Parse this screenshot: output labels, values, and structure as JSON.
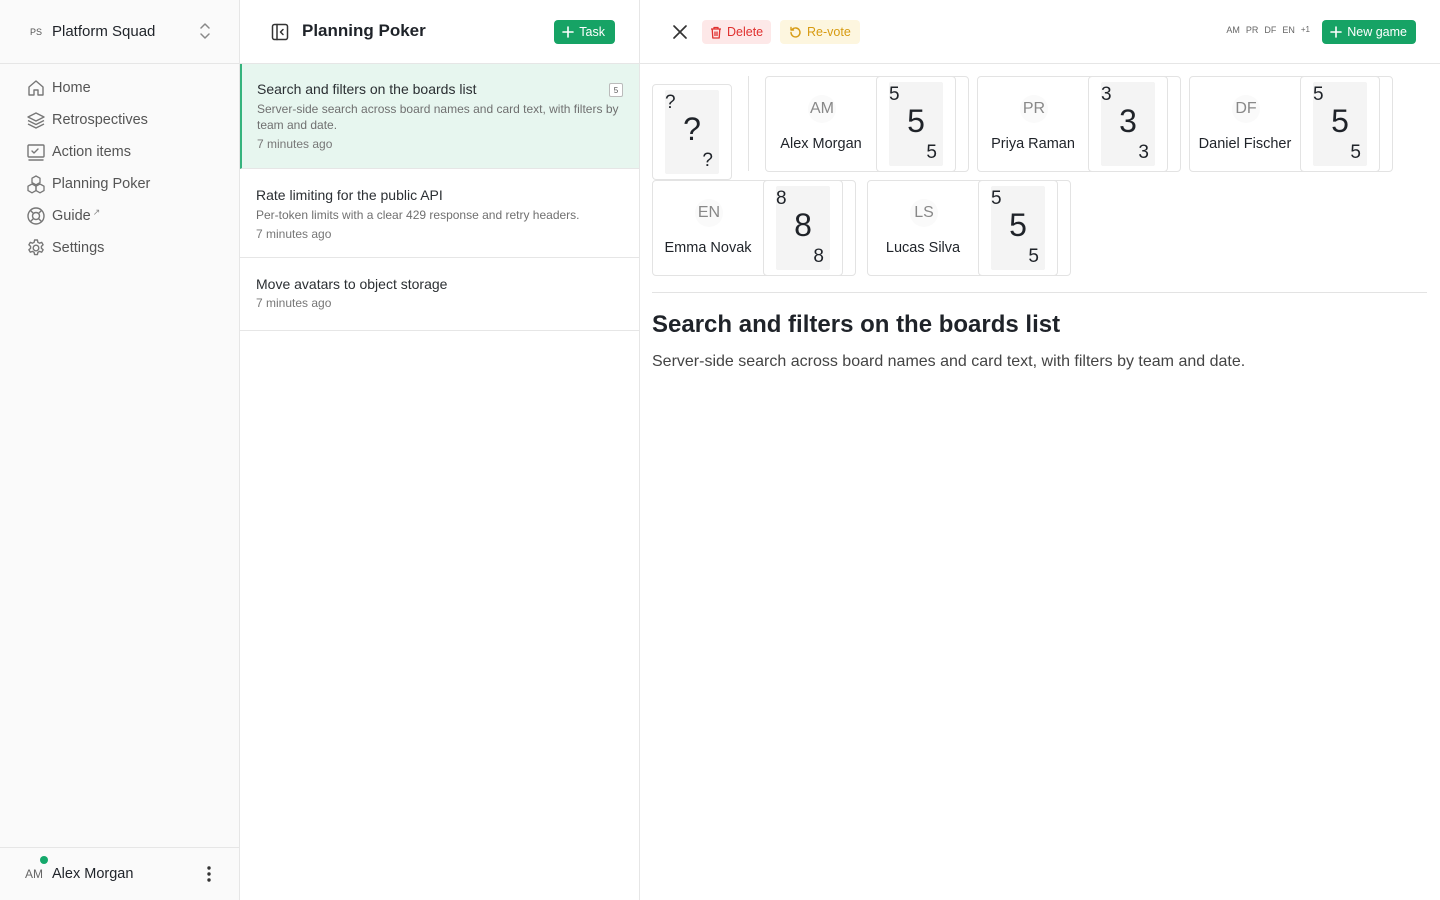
{
  "sidebar": {
    "team": {
      "initials": "PS",
      "name": "Platform Squad"
    },
    "nav": [
      {
        "label": "Home",
        "icon": "home-icon"
      },
      {
        "label": "Retrospectives",
        "icon": "layers-icon"
      },
      {
        "label": "Action items",
        "icon": "checklist-icon"
      },
      {
        "label": "Planning Poker",
        "icon": "cubes-icon"
      },
      {
        "label": "Guide",
        "icon": "lifebuoy-icon",
        "external": "↗"
      },
      {
        "label": "Settings",
        "icon": "gear-icon"
      }
    ],
    "user": {
      "initials": "AM",
      "name": "Alex Morgan",
      "online": true
    }
  },
  "tasklist": {
    "title": "Planning Poker",
    "add_button": "Task",
    "items": [
      {
        "title": "Search and filters on the boards list",
        "description": "Server-side search across board names and card text, with filters by team and date.",
        "time": "7 minutes ago",
        "estimate": "5",
        "active": true
      },
      {
        "title": "Rate limiting for the public API",
        "description": "Per-token limits with a clear 429 response and retry headers.",
        "time": "7 minutes ago"
      },
      {
        "title": "Move avatars to object storage",
        "time": "7 minutes ago"
      }
    ]
  },
  "detail": {
    "toolbar": {
      "delete_label": "Delete",
      "revote_label": "Re-vote",
      "new_game_label": "New game"
    },
    "participants": [
      "AM",
      "PR",
      "DF",
      "EN",
      "+1"
    ],
    "my_card": "?",
    "votes": [
      {
        "initials": "AM",
        "name": "Alex Morgan",
        "value": "5"
      },
      {
        "initials": "PR",
        "name": "Priya Raman",
        "value": "3"
      },
      {
        "initials": "DF",
        "name": "Daniel Fischer",
        "value": "5"
      },
      {
        "initials": "EN",
        "name": "Emma Novak",
        "value": "8"
      },
      {
        "initials": "LS",
        "name": "Lucas Silva",
        "value": "5"
      }
    ],
    "story": {
      "title": "Search and filters on the boards list",
      "description": "Server-side search across board names and card text, with filters by team and date."
    }
  },
  "colors": {
    "accent": "#16a365",
    "danger": "#e0312f",
    "warning": "#d79b12",
    "active_bg": "#e7f6ef"
  }
}
